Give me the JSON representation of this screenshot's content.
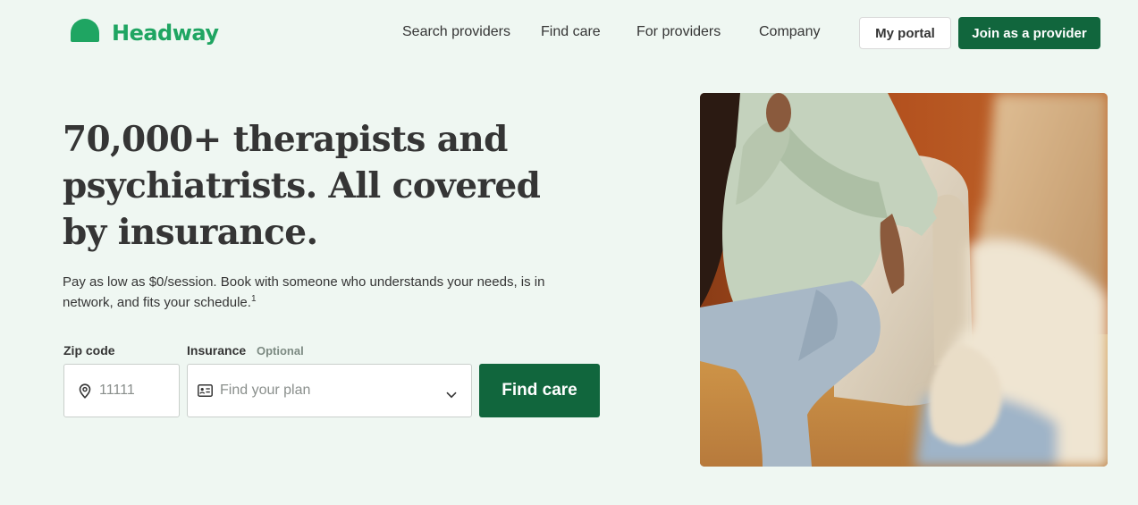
{
  "brand": {
    "name": "Headway",
    "color": "#1fa562"
  },
  "nav": {
    "items": [
      "Search providers",
      "Find care",
      "For providers",
      "Company"
    ],
    "portal_label": "My portal",
    "join_label": "Join as a provider"
  },
  "hero": {
    "title": "70,000+ therapists and psychiatrists. All covered by insurance.",
    "subtitle": "Pay as low as $0/session. Book with someone who understands your needs, is in network, and fits your schedule.",
    "footnote": "1"
  },
  "search": {
    "zip_label": "Zip code",
    "zip_placeholder": "11111",
    "insurance_label": "Insurance",
    "insurance_optional": "Optional",
    "insurance_placeholder": "Find your plan",
    "submit_label": "Find care"
  },
  "icons": {
    "zip": "map-pin-icon",
    "insurance": "id-card-icon",
    "dropdown": "chevron-down-icon"
  },
  "colors": {
    "primary": "#11663d",
    "background": "#eff7f2",
    "text": "#353535"
  }
}
